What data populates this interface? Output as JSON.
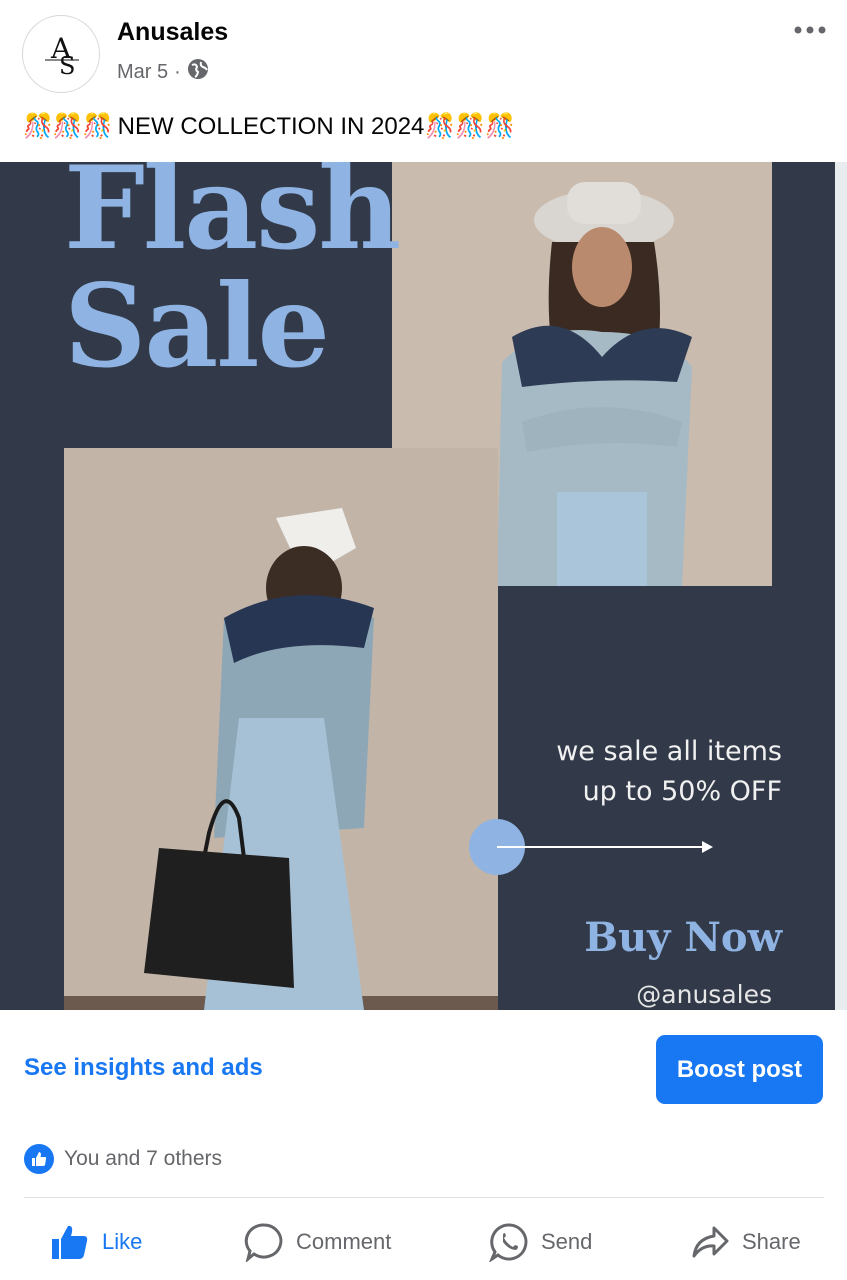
{
  "post": {
    "page_name": "Anusales",
    "date": "Mar 5",
    "separator": "·",
    "privacy_icon": "globe-icon",
    "caption_text": "NEW COLLECTION IN 2024",
    "caption_decoration": "🎊🎊🎊"
  },
  "image": {
    "headline_line1": "Flash",
    "headline_line2": "Sale",
    "promo_line1": "we sale all items",
    "promo_line2": "up to 50% OFF",
    "cta": "Buy Now",
    "handle": "@anusales",
    "colors": {
      "background": "#323a49",
      "accent": "#8fb3e3",
      "photo_bg": "#c7b8ab"
    }
  },
  "insights": {
    "link": "See insights and ads",
    "boost_button": "Boost post"
  },
  "reactions": {
    "summary": "You and 7 others"
  },
  "actions": {
    "like": "Like",
    "comment": "Comment",
    "send": "Send",
    "share": "Share"
  },
  "colors": {
    "brand_blue": "#1877f2",
    "secondary_text": "#65676b"
  }
}
